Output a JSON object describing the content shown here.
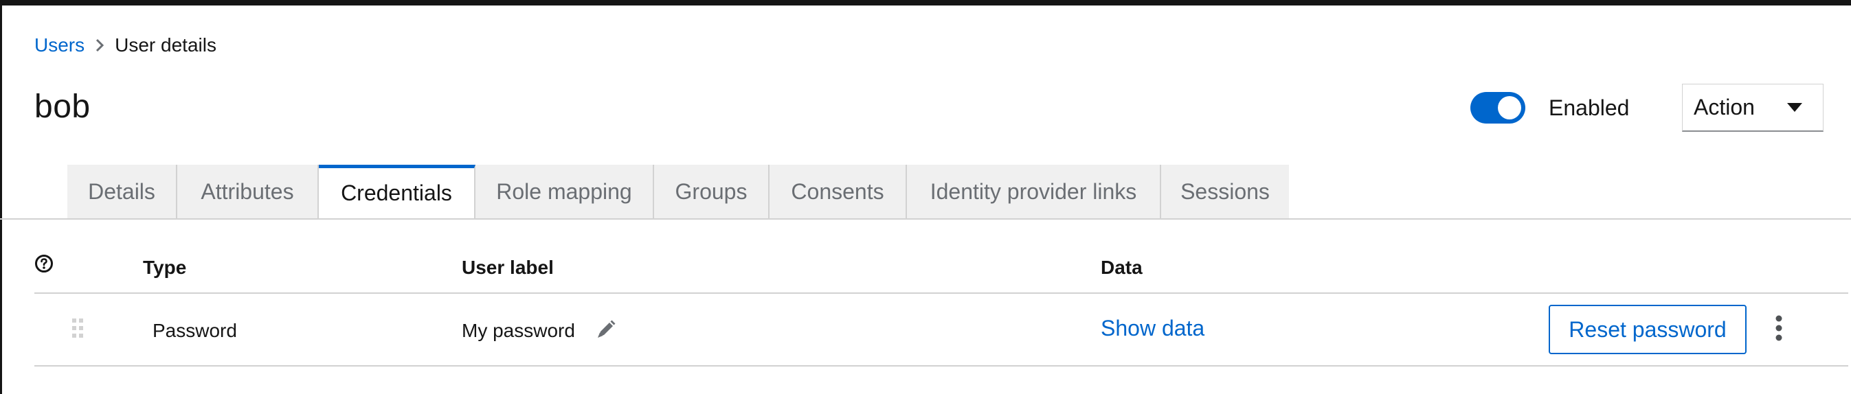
{
  "breadcrumb": {
    "parent": "Users",
    "current": "User details",
    "separator_icon": "chevron-right-icon"
  },
  "page": {
    "title": "bob"
  },
  "header_controls": {
    "enabled_label": "Enabled",
    "enabled": true,
    "action_label": "Action",
    "accent_color": "#0066cc"
  },
  "tabs": [
    {
      "label": "Details",
      "active": false
    },
    {
      "label": "Attributes",
      "active": false
    },
    {
      "label": "Credentials",
      "active": true
    },
    {
      "label": "Role mapping",
      "active": false
    },
    {
      "label": "Groups",
      "active": false
    },
    {
      "label": "Consents",
      "active": false
    },
    {
      "label": "Identity provider links",
      "active": false
    },
    {
      "label": "Sessions",
      "active": false
    }
  ],
  "credentials_table": {
    "help_icon": "question-circle-icon",
    "columns": [
      "Type",
      "User label",
      "Data"
    ],
    "rows": [
      {
        "type": "Password",
        "user_label": "My password",
        "data_link": "Show data",
        "action_button": "Reset password",
        "drag_icon": "grip-vertical-icon",
        "edit_icon": "pencil-icon",
        "menu_icon": "kebab-icon"
      }
    ]
  }
}
